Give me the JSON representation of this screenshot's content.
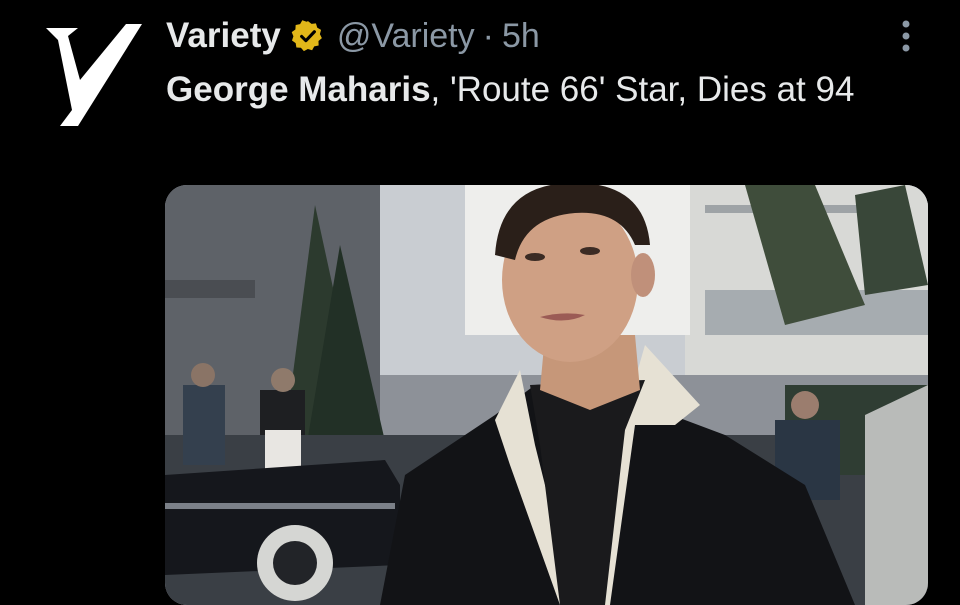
{
  "account": {
    "name": "Variety",
    "handle": "@Variety",
    "separator": "·",
    "time": "5h",
    "verified_badge_color": "#E2B719",
    "avatar_letter": "V"
  },
  "tweet": {
    "bold_text": "George Maharis",
    "rest_text": ", 'Route 66' Star, Dies at 94"
  },
  "icons": {
    "badge": "verified-badge-icon",
    "more": "more-options-icon"
  }
}
